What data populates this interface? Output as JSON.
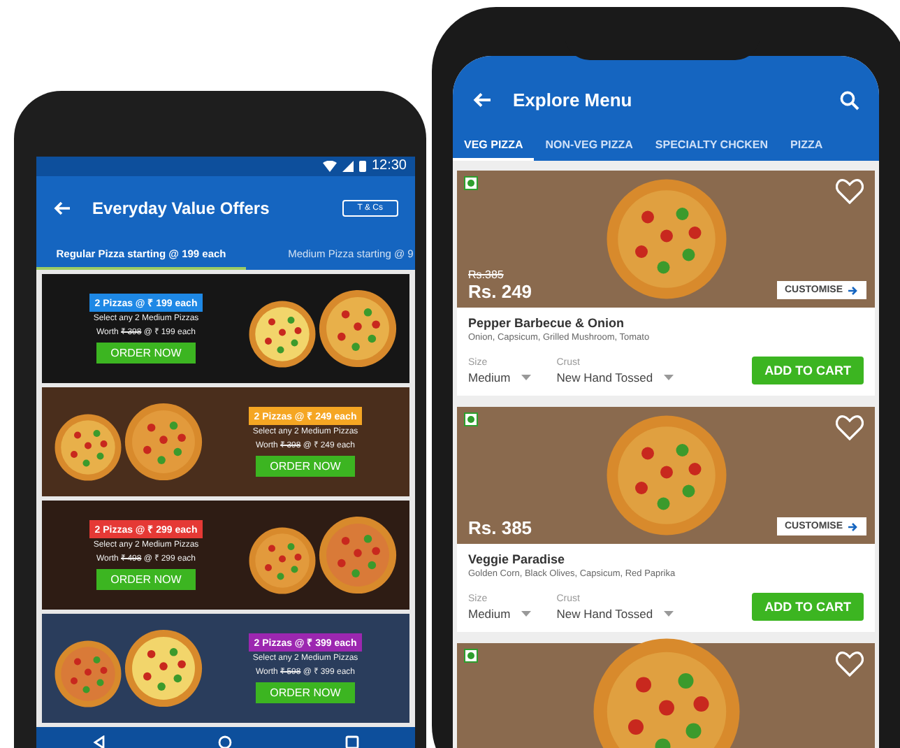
{
  "offers_screen": {
    "status_bar": {
      "time": "12:30"
    },
    "title": "Everyday Value Offers",
    "terms_button": "T & Cs",
    "tabs": [
      {
        "label": "Regular Pizza starting @ 199 each",
        "selected": true
      },
      {
        "label": "Medium Pizza starting @ 9",
        "selected": false
      }
    ],
    "offers": [
      {
        "badge": "2 Pizzas @ ₹ 199 each",
        "color": "#1e88e5",
        "kind": "text-left",
        "line1": "Select any 2 Medium Pizzas",
        "worth": "Worth",
        "old_price": "₹ 398",
        "offer_price": "@ ₹ 199 each",
        "button": "ORDER NOW"
      },
      {
        "badge": "2 Pizzas @ ₹ 249 each",
        "color": "#f5a623",
        "kind": "text-right",
        "line1": "Select any 2 Medium Pizzas",
        "worth": "Worth",
        "old_price": "₹ 398",
        "offer_price": "@ ₹ 249 each",
        "button": "ORDER NOW"
      },
      {
        "badge": "2 Pizzas @ ₹ 299 each",
        "color": "#e53935",
        "kind": "text-left",
        "line1": "Select any 2 Medium Pizzas",
        "worth": "Worth",
        "old_price": "₹ 498",
        "offer_price": "@ ₹ 299 each",
        "button": "ORDER NOW"
      },
      {
        "badge": "2 Pizzas @ ₹ 399 each",
        "color": "#9c27b0",
        "kind": "text-right",
        "line1": "Select any 2 Medium Pizzas",
        "worth": "Worth",
        "old_price": "₹ 598",
        "offer_price": "@ ₹ 399 each",
        "button": "ORDER NOW"
      }
    ]
  },
  "menu_screen": {
    "title": "Explore Menu",
    "tabs": [
      {
        "label": "VEG PIZZA",
        "selected": true
      },
      {
        "label": "NON-VEG PIZZA",
        "selected": false
      },
      {
        "label": "SPECIALTY CHCKEN",
        "selected": false
      },
      {
        "label": "PIZZA",
        "selected": false
      }
    ],
    "products": [
      {
        "veg": true,
        "old_price": "Rs.385",
        "price": "Rs. 249",
        "customise": "CUSTOMISE",
        "name": "Pepper Barbecue & Onion",
        "toppings": "Onion, Capsicum, Grilled Mushroom, Tomato",
        "size_label": "Size",
        "size": "Medium",
        "crust_label": "Crust",
        "crust": "New Hand Tossed",
        "button": "ADD TO CART"
      },
      {
        "veg": true,
        "price": "Rs. 385",
        "customise": "CUSTOMISE",
        "name": "Veggie Paradise",
        "toppings": "Golden Corn, Black Olives, Capsicum, Red Paprika",
        "size_label": "Size",
        "size": "Medium",
        "crust_label": "Crust",
        "crust": "New Hand Tossed",
        "button": "ADD TO CART"
      },
      {
        "veg": true
      }
    ]
  }
}
